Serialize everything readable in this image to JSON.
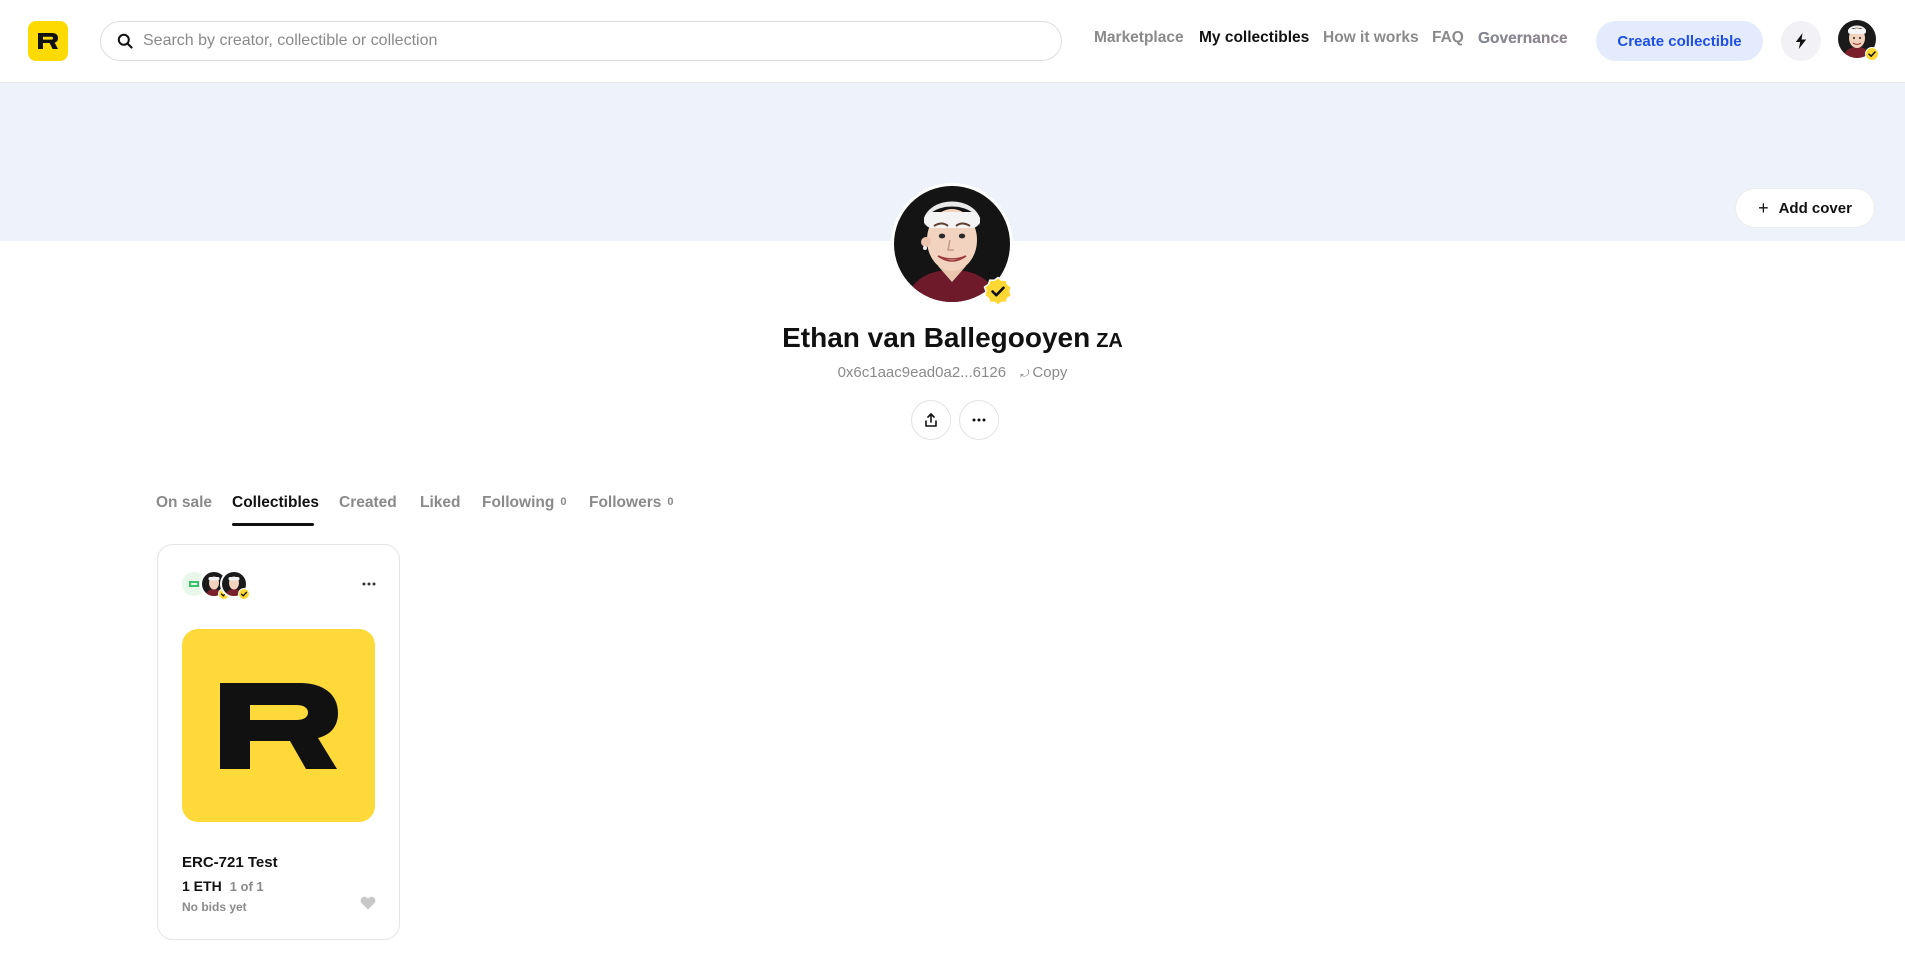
{
  "header": {
    "logo_letter": "R",
    "search_placeholder": "Search by creator, collectible or collection",
    "nav": {
      "marketplace": "Marketplace",
      "my_collectibles": "My collectibles",
      "how_it_works": "How it works",
      "faq": "FAQ",
      "governance": "Governance"
    },
    "create_label": "Create collectible",
    "bolt_icon": "bolt-icon",
    "brand_color": "#feda03",
    "accent_color": "#1d4fe5"
  },
  "cover": {
    "add_cover_label": "Add cover",
    "background_color": "#eef2fb"
  },
  "profile": {
    "name": "Ethan van Ballegooyen",
    "country_code": "ZA",
    "address": "0x6c1aac9ead0a2...6126",
    "copy_label": "Copy",
    "verified": true
  },
  "tabs": [
    {
      "label": "On sale",
      "count": "",
      "active": false
    },
    {
      "label": "Collectibles",
      "count": "",
      "active": true
    },
    {
      "label": "Created",
      "count": "",
      "active": false
    },
    {
      "label": "Liked",
      "count": "",
      "active": false
    },
    {
      "label": "Following",
      "count": "0",
      "active": false
    },
    {
      "label": "Followers",
      "count": "0",
      "active": false
    }
  ],
  "collectibles": [
    {
      "title": "ERC-721 Test",
      "price": "1 ETH",
      "edition": "1 of 1",
      "bids": "No bids yet",
      "image_letter": "R",
      "image_color": "#fed93a"
    }
  ]
}
